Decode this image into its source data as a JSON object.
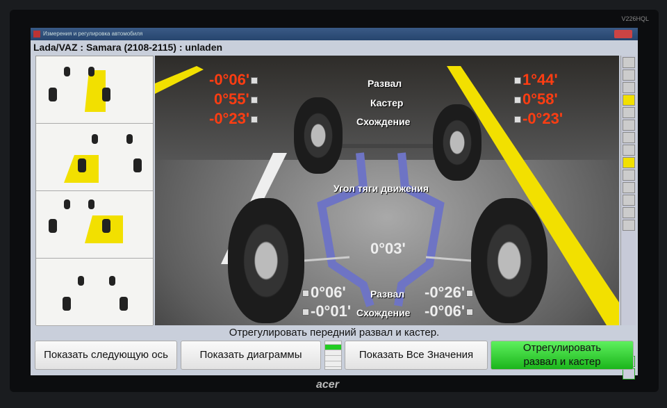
{
  "monitor": {
    "brand": "acer",
    "model": "V226HQL"
  },
  "window": {
    "title": "Измерения и регулировка автомобиля",
    "vehicle": "Lada/VAZ : Samara (2108-2115) : unladen"
  },
  "front": {
    "labels": [
      "Развал",
      "Кастер",
      "Схождение"
    ],
    "left": [
      "-0°06'",
      "0°55'",
      "-0°23'"
    ],
    "right": [
      "1°44'",
      "0°58'",
      "-0°23'"
    ]
  },
  "thrust": {
    "label": "Угол тяги движения",
    "value": "0°03'"
  },
  "rear": {
    "labels": [
      "Развал",
      "Схождение"
    ],
    "left": [
      "0°06'",
      "-0°01'"
    ],
    "right": [
      "-0°26'",
      "-0°06'"
    ]
  },
  "status": "Отрегулировать передний развал и кастер.",
  "buttons": {
    "next_axle": "Показать следующую ось",
    "diagrams": "Показать диаграммы",
    "all_values": "Показать Все Значения",
    "adjust": "Отрегулировать развал и кастер"
  },
  "colors": {
    "value_red": "#ff3d12",
    "accent_yellow": "#f2e000",
    "button_green": "#1bb51b"
  }
}
